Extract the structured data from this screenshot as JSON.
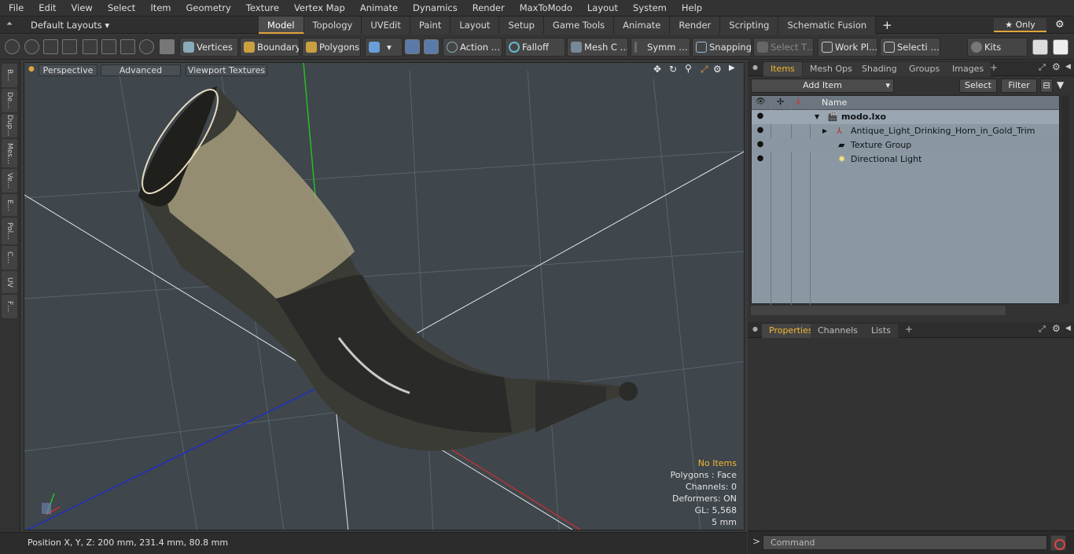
{
  "menubar": {
    "items": [
      "File",
      "Edit",
      "View",
      "Select",
      "Item",
      "Geometry",
      "Texture",
      "Vertex Map",
      "Animate",
      "Dynamics",
      "Render",
      "MaxToModo",
      "Layout",
      "System",
      "Help"
    ]
  },
  "layoutbar": {
    "layout_name": "Default Layouts ▾",
    "tabs": [
      "Model",
      "Topology",
      "UVEdit",
      "Paint",
      "Layout",
      "Setup",
      "Game Tools",
      "Animate",
      "Render",
      "Scripting",
      "Schematic Fusion"
    ],
    "active_tab": "Model",
    "add_tab": "+",
    "only_label": "★  Only",
    "gear_icon": "gear-icon"
  },
  "toolbar": {
    "vertices": "Vertices",
    "boundary": "Boundary",
    "polygons": "Polygons",
    "action": "Action  …",
    "falloff": "Falloff",
    "mesh": "Mesh C …",
    "symm": "Symm …",
    "snapping": "Snapping",
    "select_t": "Select T…",
    "work_pl": "Work Pl…",
    "selecti": "Selecti …",
    "kits": "Kits"
  },
  "leftstrip": {
    "tabs": [
      "B…",
      "De…",
      "Dup…",
      "Mes…",
      "Ve…",
      "E…",
      "Pol…",
      "C…",
      "UV",
      "F…"
    ]
  },
  "viewport": {
    "perspective": "Perspective",
    "advanced": "Advanced",
    "textures": "Viewport Textures",
    "stats": {
      "no_items": "No Items",
      "polygons": "Polygons : Face",
      "channels": "Channels: 0",
      "deformers": "Deformers: ON",
      "gl": "GL: 5,568",
      "unit": "5 mm"
    }
  },
  "status": {
    "position": "Position X, Y, Z:   200 mm, 231.4 mm, 80.8 mm"
  },
  "items_panel": {
    "tabs": [
      "Items",
      "Mesh Ops",
      "Shading",
      "Groups",
      "Images",
      "+"
    ],
    "active_tab": "Items",
    "add_item": "Add Item",
    "select": "Select",
    "filter": "Filter",
    "col_name": "Name",
    "rows": [
      {
        "label": "modo.lxo",
        "bold": true
      },
      {
        "label": "Antique_Light_Drinking_Horn_in_Gold_Trim",
        "bold": false
      },
      {
        "label": "Texture Group",
        "bold": false
      },
      {
        "label": "Directional Light",
        "bold": false
      }
    ]
  },
  "props_panel": {
    "tabs": [
      "Properties",
      "Channels",
      "Lists",
      "+"
    ],
    "active_tab": "Properties"
  },
  "command": {
    "placeholder": "Command",
    "prompt": ">"
  }
}
